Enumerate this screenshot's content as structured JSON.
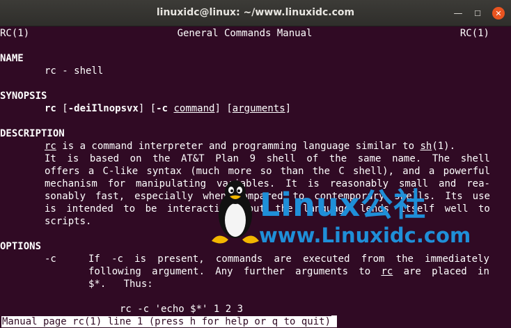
{
  "window": {
    "title": "linuxidc@linux: ~/www.linuxidc.com",
    "minimize_icon": "minimize-icon",
    "maximize_icon": "maximize-icon",
    "close_icon": "close-icon",
    "accent_color": "#e95420"
  },
  "man": {
    "header_left": "RC(1)",
    "header_center": "General Commands Manual",
    "header_right": "RC(1)",
    "name_heading": "NAME",
    "name_line": "rc - shell",
    "synopsis_heading": "SYNOPSIS",
    "synopsis": {
      "cmd": "rc",
      "open1": " [",
      "flags": "-deiIlnopsvx",
      "mid1": "] [",
      "c_flag": "-c",
      "sp": " ",
      "command": "command",
      "mid2": "] [",
      "arguments": "arguments",
      "close": "]"
    },
    "description_heading": "DESCRIPTION",
    "desc1": {
      "rc": "rc",
      "w1": " is a command interpreter and programming language similar to ",
      "sh": "sh",
      "tail": "(1)."
    },
    "desc2": [
      "It",
      "is",
      "based",
      "on",
      "the",
      "AT&T",
      "Plan",
      "9",
      "shell",
      "of",
      "the",
      "same",
      "name.",
      "The",
      "shell"
    ],
    "desc3": [
      "offers",
      "a",
      "C-like",
      "syntax",
      "(much",
      "more",
      "so",
      "than",
      "the",
      "C",
      "shell),",
      "and",
      "a",
      "powerful"
    ],
    "desc4": [
      "mechanism",
      "for",
      "manipulating",
      "variables.",
      "It",
      "is",
      "reasonably",
      "small",
      "and",
      "rea‐"
    ],
    "desc5": [
      "sonably",
      "fast,",
      "especially",
      "when",
      "compared",
      "to",
      "contemporary",
      "shells.",
      "Its",
      "use"
    ],
    "desc6": [
      "is",
      "intended",
      "to",
      "be",
      "interactive,",
      "but",
      "the",
      "language",
      "lends",
      "itself",
      "well",
      "to"
    ],
    "desc7": "scripts.",
    "options_heading": "OPTIONS",
    "opt_flag": "-c",
    "opt1": [
      "If",
      "-c",
      "is",
      "present,",
      "commands",
      "are",
      "executed",
      "from",
      "the",
      "immediately"
    ],
    "opt2": [
      "following",
      "argument.",
      "Any",
      "further",
      "arguments",
      "to",
      "rc",
      "are",
      "placed",
      "in"
    ],
    "opt3": "$*.   Thus:",
    "example": "rc -c 'echo $*' 1 2 3",
    "status": "Manual page rc(1) line 1 (press h for help or q to quit)"
  },
  "watermark": {
    "brand": "Linux公社",
    "url": "www.Linuxidc.com",
    "mascot_icon": "penguin-icon",
    "color": "#1f8fd8"
  }
}
